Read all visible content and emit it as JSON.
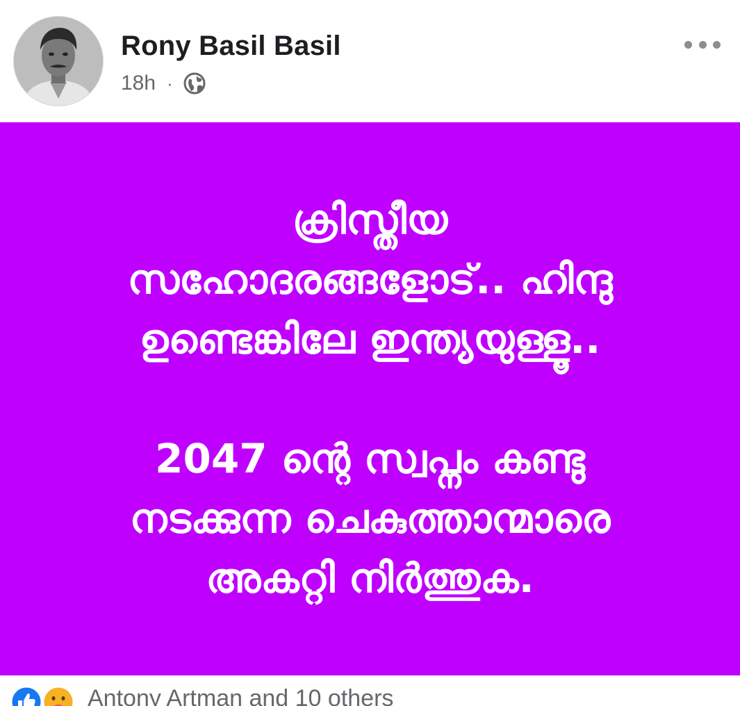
{
  "post": {
    "author_name": "Rony Basil Basil",
    "timestamp": "18h",
    "separator": "·",
    "privacy_icon": "globe-icon",
    "more_icon": "more-options-icon",
    "card_color": "#bf00ff",
    "card_text_color": "#ffffff",
    "card_paragraphs": [
      {
        "lines": [
          "ക്രിസ്തീയ",
          "സഹോദരങ്ങളോട്.. ഹിന്ദു",
          "ഉണ്ടെങ്കിലേ ഇന്ത്യയുള്ളൂ.."
        ]
      },
      {
        "lines": [
          "2047 ന്റെ സ്വപ്നം കണ്ടു",
          "നടക്കുന്ന ചെകുത്താന്മാരെ",
          "അകറ്റി നിർത്തുക."
        ]
      }
    ]
  },
  "reactions": {
    "icons": [
      "like-icon",
      "care-icon"
    ],
    "text": "Antony Artman and 10 others"
  },
  "colors": {
    "author_name": "#1c1e21",
    "secondary_text": "#65676b",
    "like_blue": "#1877f2",
    "care_yellow": "#f7b125"
  }
}
